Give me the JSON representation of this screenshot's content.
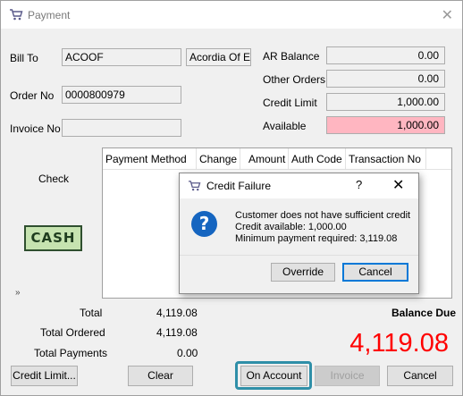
{
  "window": {
    "title": "Payment",
    "icon": "cart-icon"
  },
  "form": {
    "bill_to_label": "Bill To",
    "bill_to_code": "ACOOF",
    "bill_to_name": "Acordia Of Eva",
    "order_no_label": "Order No",
    "order_no": "0000800979",
    "invoice_no_label": "Invoice No",
    "invoice_no": "",
    "ar_balance_label": "AR Balance",
    "ar_balance": "0.00",
    "other_orders_label": "Other Orders",
    "other_orders": "0.00",
    "credit_limit_label": "Credit Limit",
    "credit_limit": "1,000.00",
    "available_label": "Available",
    "available": "1,000.00"
  },
  "grid": {
    "columns": [
      "Payment Method",
      "Change",
      "Amount",
      "Auth Code",
      "Transaction No"
    ]
  },
  "payment_methods": {
    "check_label": "Check",
    "cash_label": "CASH"
  },
  "totals": {
    "total_label": "Total",
    "total": "4,119.08",
    "total_ordered_label": "Total Ordered",
    "total_ordered": "4,119.08",
    "total_payments_label": "Total Payments",
    "total_payments": "0.00",
    "balance_due_label": "Balance Due",
    "balance_due": "4,119.08"
  },
  "buttons": {
    "credit_limit": "Credit Limit...",
    "clear": "Clear",
    "on_account": "On Account",
    "invoice": "Invoice",
    "cancel": "Cancel"
  },
  "dialog": {
    "title": "Credit Failure",
    "help": "?",
    "message_line1": "Customer does not have sufficient credit",
    "message_line2": "Credit available: 1,000.00",
    "message_line3": "Minimum payment required: 3,119.08",
    "override_label": "Override",
    "cancel_label": "Cancel"
  },
  "colors": {
    "available_bg": "#ffb6c1",
    "balance_due_text": "#ff0000",
    "focus_ring": "#2f8fa8",
    "question_icon": "#1565c0"
  }
}
